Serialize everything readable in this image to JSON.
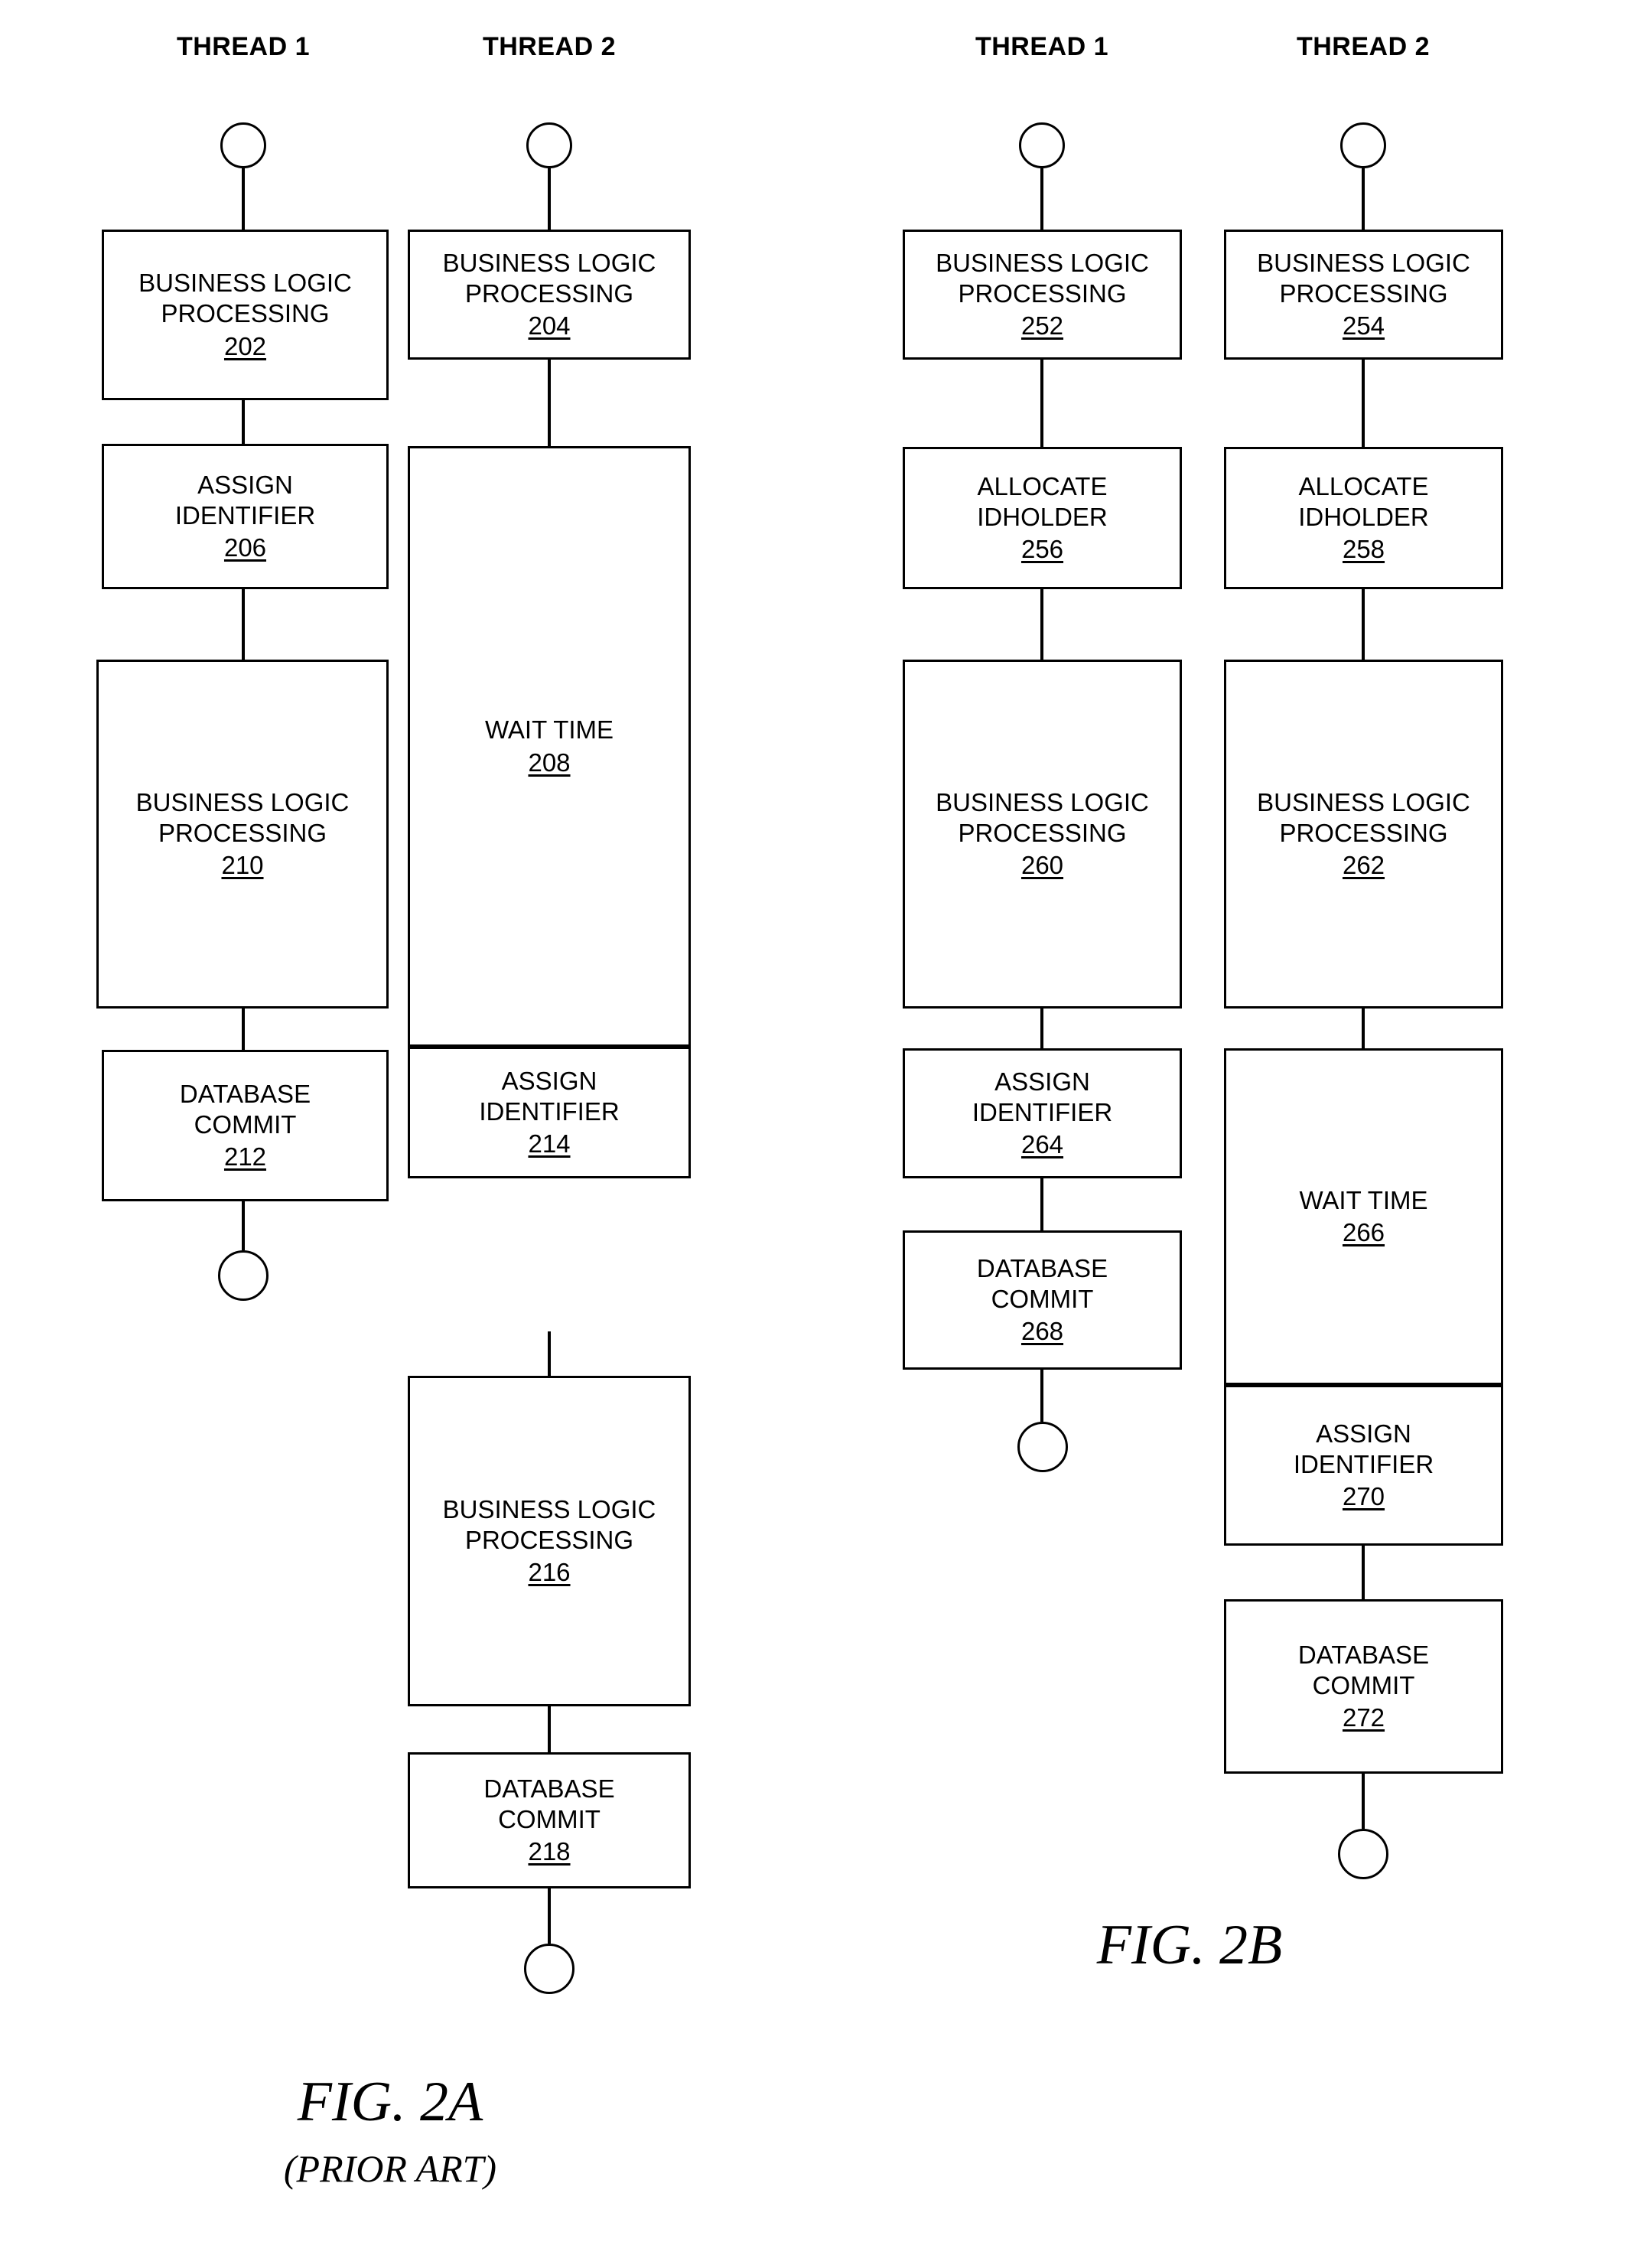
{
  "figures": [
    {
      "id": "fig-2a",
      "caption": "FIG. 2A",
      "subcaption": "(PRIOR ART)",
      "columns": [
        {
          "id": "fig2a-thread1",
          "header": "THREAD 1"
        },
        {
          "id": "fig2a-thread2",
          "header": "THREAD 2"
        }
      ]
    },
    {
      "id": "fig-2b",
      "caption": "FIG. 2B",
      "subcaption": "",
      "columns": [
        {
          "id": "fig2b-thread1",
          "header": "THREAD 1"
        },
        {
          "id": "fig2b-thread2",
          "header": "THREAD 2"
        }
      ]
    }
  ],
  "nodes": {
    "n202": {
      "label": "BUSINESS LOGIC\nPROCESSING",
      "ref": "202"
    },
    "n206": {
      "label": "ASSIGN\nIDENTIFIER",
      "ref": "206"
    },
    "n210": {
      "label": "BUSINESS LOGIC\nPROCESSING",
      "ref": "210"
    },
    "n212": {
      "label": "DATABASE\nCOMMIT",
      "ref": "212"
    },
    "n204": {
      "label": "BUSINESS LOGIC\nPROCESSING",
      "ref": "204"
    },
    "n208": {
      "label": "WAIT TIME",
      "ref": "208"
    },
    "n214": {
      "label": "ASSIGN\nIDENTIFIER",
      "ref": "214"
    },
    "n216": {
      "label": "BUSINESS LOGIC\nPROCESSING",
      "ref": "216"
    },
    "n218": {
      "label": "DATABASE\nCOMMIT",
      "ref": "218"
    },
    "n252": {
      "label": "BUSINESS LOGIC\nPROCESSING",
      "ref": "252"
    },
    "n256": {
      "label": "ALLOCATE\nIDHOLDER",
      "ref": "256"
    },
    "n260": {
      "label": "BUSINESS LOGIC\nPROCESSING",
      "ref": "260"
    },
    "n264": {
      "label": "ASSIGN\nIDENTIFIER",
      "ref": "264"
    },
    "n268": {
      "label": "DATABASE\nCOMMIT",
      "ref": "268"
    },
    "n254": {
      "label": "BUSINESS LOGIC\nPROCESSING",
      "ref": "254"
    },
    "n258": {
      "label": "ALLOCATE\nIDHOLDER",
      "ref": "258"
    },
    "n262": {
      "label": "BUSINESS LOGIC\nPROCESSING",
      "ref": "262"
    },
    "n266": {
      "label": "WAIT TIME",
      "ref": "266"
    },
    "n270": {
      "label": "ASSIGN\nIDENTIFIER",
      "ref": "270"
    },
    "n272": {
      "label": "DATABASE\nCOMMIT",
      "ref": "272"
    }
  },
  "colors": {
    "stroke": "#000000",
    "background": "#ffffff"
  }
}
